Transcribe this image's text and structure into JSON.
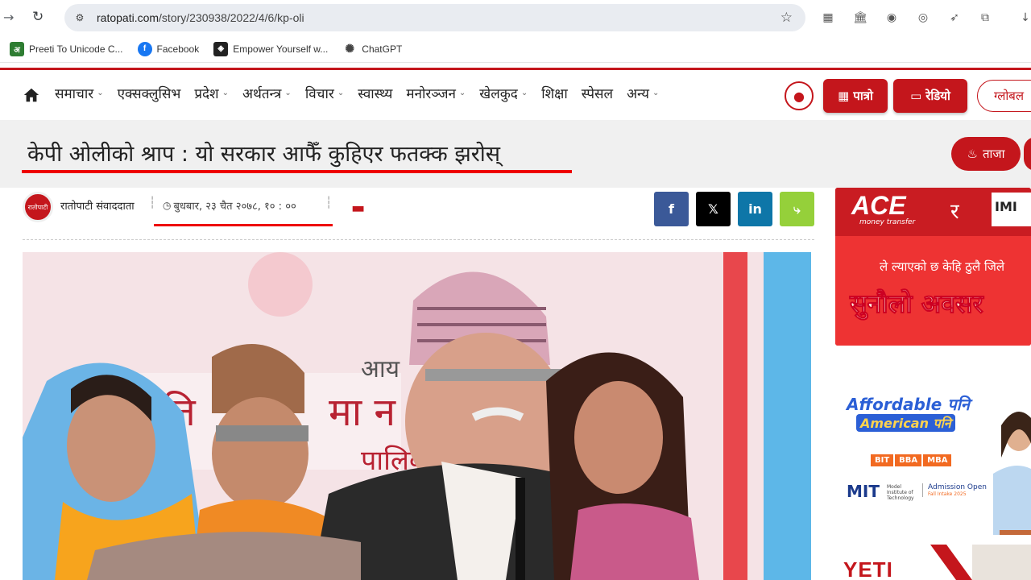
{
  "browser": {
    "url_host": "ratopati.com",
    "url_path": "/story/230938/2022/4/6/kp-oli",
    "bookmarks": [
      {
        "label": "Preeti To Unicode C...",
        "icon": "preeti-icon",
        "color": "#2e7d32"
      },
      {
        "label": "Facebook",
        "icon": "facebook-icon",
        "color": "#1877f2"
      },
      {
        "label": "Empower Yourself w...",
        "icon": "empower-icon",
        "color": "#222222"
      },
      {
        "label": "ChatGPT",
        "icon": "chatgpt-icon",
        "color": "#444444"
      }
    ]
  },
  "site": {
    "accent_color": "#c4161c",
    "menu": [
      {
        "label": "समाचार",
        "dropdown": true
      },
      {
        "label": "एक्सक्लुसिभ",
        "dropdown": false
      },
      {
        "label": "प्रदेश",
        "dropdown": true
      },
      {
        "label": "अर्थतन्त्र",
        "dropdown": true
      },
      {
        "label": "विचार",
        "dropdown": true
      },
      {
        "label": "स्वास्थ्य",
        "dropdown": false
      },
      {
        "label": "मनोरञ्जन",
        "dropdown": true
      },
      {
        "label": "खेलकुद",
        "dropdown": true
      },
      {
        "label": "शिक्षा",
        "dropdown": false
      },
      {
        "label": "स्पेसल",
        "dropdown": false
      },
      {
        "label": "अन्य",
        "dropdown": true
      }
    ],
    "patro_label": "पात्रो",
    "radio_label": "रेडियो",
    "global_label": "ग्लोबल",
    "taja_label": "ताजा"
  },
  "article": {
    "headline": "केपी ओलीको श्राप : यो सरकार आफैँ कुहिएर फतक्क झरोस्",
    "author": "रातोपाटी संवाददाता",
    "author_avatar_text": "रातोपाटी",
    "date": "बुधबार, २३ चैत २०७८, १० : ००"
  },
  "share": [
    {
      "name": "facebook",
      "glyph": "f",
      "color": "#3b5998"
    },
    {
      "name": "x",
      "glyph": "𝕏",
      "color": "#000000"
    },
    {
      "name": "linkedin",
      "glyph": "in",
      "color": "#0e76a8"
    },
    {
      "name": "sharethis",
      "glyph": "<",
      "color": "#95d03a"
    }
  ],
  "ads": {
    "ace": {
      "brand": "ACE",
      "sub": "money transfer",
      "ra": "र",
      "imb": "IMI",
      "line": "ले ल्याएको छ केहि ठुलै जिले",
      "big": "सुनौलो अवसर"
    },
    "mit": {
      "line1": "Affordable पनि",
      "line2": "American पनि",
      "tags": [
        "BIT",
        "BBA",
        "MBA"
      ],
      "logo": "MIT",
      "logo_sub": "Model Institute of Technology",
      "admission": "Admission Open",
      "intake": "Fall Intake 2025"
    },
    "yeti": {
      "text": "YETI"
    }
  }
}
